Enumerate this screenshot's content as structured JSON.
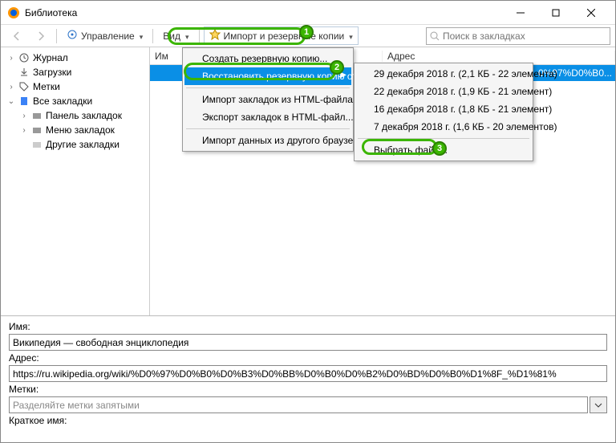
{
  "window": {
    "title": "Библиотека"
  },
  "toolbar": {
    "manage": "Управление",
    "views": "Вид",
    "import_backup": "Импорт и резервные копии"
  },
  "search": {
    "placeholder": "Поиск в закладках"
  },
  "sidebar": {
    "history": "Журнал",
    "downloads": "Загрузки",
    "tags": "Метки",
    "all_bookmarks": "Все закладки",
    "toolbar_folder": "Панель закладок",
    "menu_folder": "Меню закладок",
    "other_folder": "Другие закладки"
  },
  "columns": {
    "name": "Им",
    "address": "Адрес"
  },
  "row0": {
    "addr_frag": "0%97%D0%B0..."
  },
  "menu": {
    "create_backup": "Создать резервную копию...",
    "restore_from": "Восстановить резервную копию от",
    "import_html": "Импорт закладок из HTML-файла...",
    "export_html": "Экспорт закладок в HTML-файл...",
    "import_browser": "Импорт данных из другого браузера..."
  },
  "submenu": {
    "item1": "29 декабря 2018 г. (2,1 КБ - 22 элемента)",
    "item2": "22 декабря 2018 г. (1,9 КБ - 21 элемент)",
    "item3": "16 декабря 2018 г. (1,8 КБ - 21 элемент)",
    "item4": "7 декабря 2018 г. (1,6 КБ - 20 элементов)",
    "choose_file": "Выбрать файл..."
  },
  "details": {
    "name_label": "Имя:",
    "name_value": "Википедия — свободная энциклопедия",
    "addr_label": "Адрес:",
    "addr_value": "https://ru.wikipedia.org/wiki/%D0%97%D0%B0%D0%B3%D0%BB%D0%B0%D0%B2%D0%BD%D0%B0%D1%8F_%D1%81%",
    "tags_label": "Метки:",
    "tags_placeholder": "Разделяйте метки запятыми",
    "short_label": "Краткое имя:"
  },
  "markers": {
    "n1": "1",
    "n2": "2",
    "n3": "3"
  }
}
